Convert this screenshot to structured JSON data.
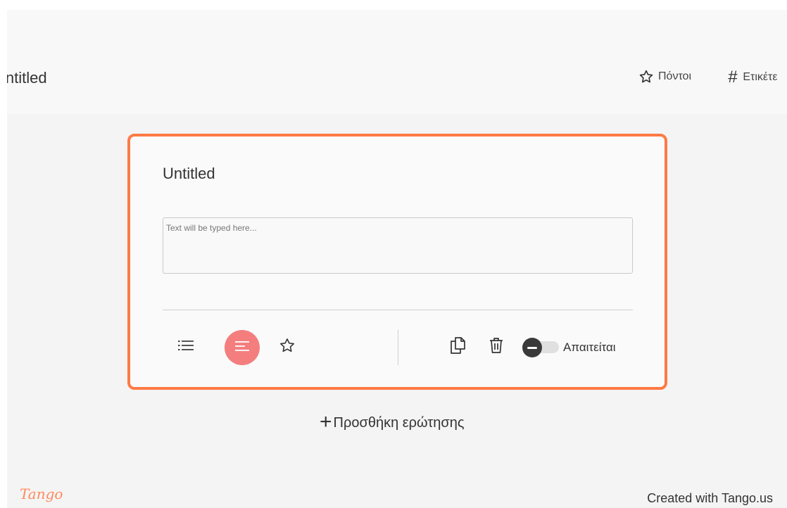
{
  "header": {
    "title": "Untitled",
    "points_label": "Πόντοι",
    "tags_label": "Ετικέτε"
  },
  "question_card": {
    "title": "Untitled",
    "answer_placeholder": "Text will be typed here...",
    "required_label": "Απαιτείται",
    "required_enabled": false,
    "accent_color": "#ff7a45",
    "active_tool_color": "#f47e7e",
    "tools_left": [
      "list-icon",
      "text-icon",
      "star-icon"
    ],
    "tools_right": [
      "copy-icon",
      "trash-icon"
    ]
  },
  "add_question": {
    "plus": "+",
    "label": "Προσθήκη ερώτησης"
  },
  "footer": {
    "logo": "Tango",
    "created_with": "Created with Tango.us"
  }
}
